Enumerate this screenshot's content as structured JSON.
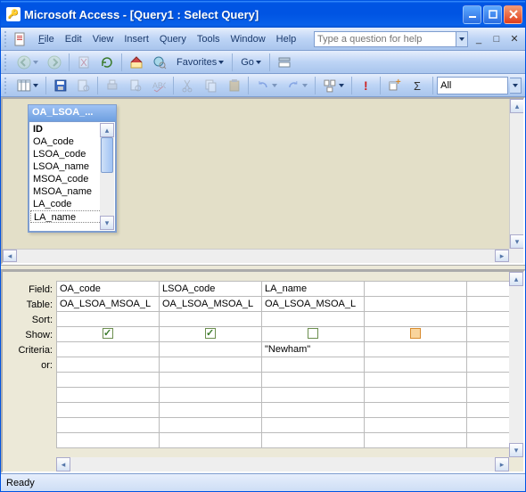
{
  "window": {
    "title": "Microsoft Access - [Query1 : Select Query]"
  },
  "menu": {
    "file": "File",
    "edit": "Edit",
    "view": "View",
    "insert": "Insert",
    "query": "Query",
    "tools": "Tools",
    "window": "Window",
    "help": "Help",
    "help_placeholder": "Type a question for help"
  },
  "toolbar_web": {
    "favorites": "Favorites",
    "go": "Go"
  },
  "toolbar_query": {
    "combo_value": "All"
  },
  "table_window": {
    "title": "OA_LSOA_...",
    "fields": [
      "ID",
      "OA_code",
      "LSOA_code",
      "LSOA_name",
      "MSOA_code",
      "MSOA_name",
      "LA_code",
      "LA_name"
    ]
  },
  "qbe": {
    "row_labels": {
      "field": "Field:",
      "table": "Table:",
      "sort": "Sort:",
      "show": "Show:",
      "criteria": "Criteria:",
      "or": "or:"
    },
    "columns": [
      {
        "field": "OA_code",
        "table": "OA_LSOA_MSOA_L",
        "show": true,
        "criteria": ""
      },
      {
        "field": "LSOA_code",
        "table": "OA_LSOA_MSOA_L",
        "show": true,
        "criteria": ""
      },
      {
        "field": "LA_name",
        "table": "OA_LSOA_MSOA_L",
        "show": false,
        "criteria": "\"Newham\""
      },
      {
        "field": "",
        "table": "",
        "show": false,
        "criteria": ""
      }
    ]
  },
  "status": {
    "text": "Ready"
  }
}
